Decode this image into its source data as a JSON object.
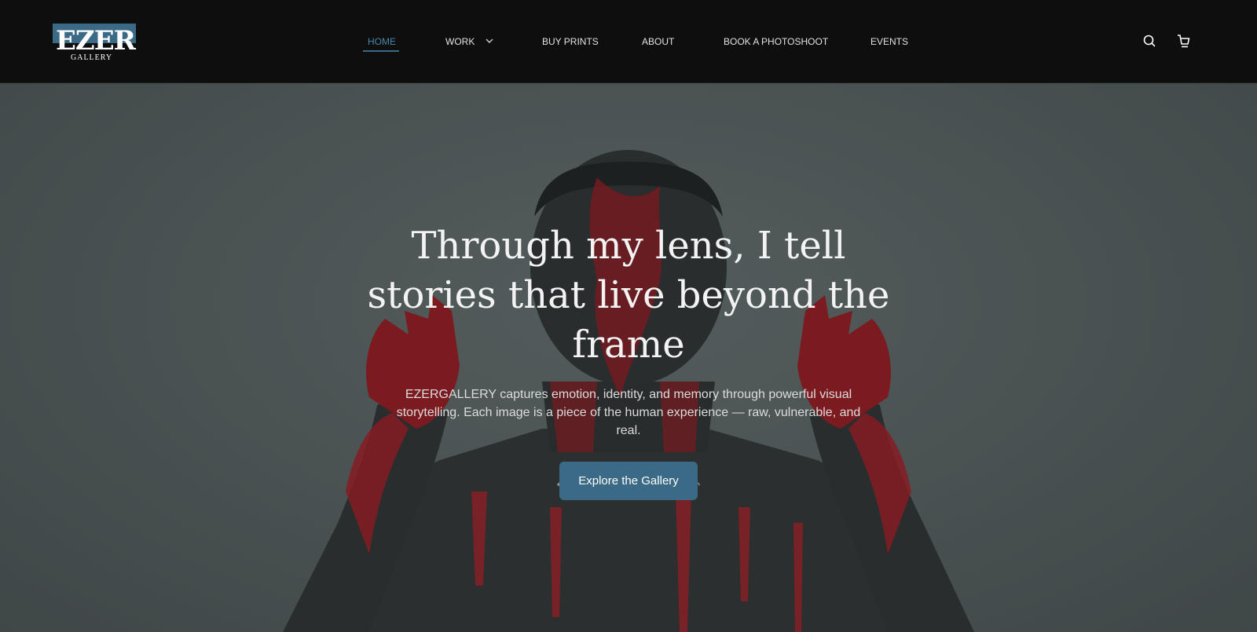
{
  "brand": {
    "logo_main": "EZER",
    "logo_sub": "GALLERY",
    "accent": "#3a6a86"
  },
  "nav": {
    "items": [
      {
        "label": "HOME",
        "active": true
      },
      {
        "label": "WORK",
        "has_dropdown": true
      },
      {
        "label": "BUY PRINTS"
      },
      {
        "label": "ABOUT"
      },
      {
        "label": "BOOK A PHOTOSHOOT"
      },
      {
        "label": "EVENTS"
      }
    ],
    "icons": [
      "search-icon",
      "cart-icon"
    ]
  },
  "hero": {
    "headline": "Through my lens, I tell stories that live beyond the frame",
    "description": "EZERGALLERY captures emotion, identity, and memory through powerful visual storytelling. Each image is a piece of the human experience — raw, vulnerable, and real.",
    "cta_label": "Explore the Gallery",
    "image_subject": "shirtless man with red paint on face, chest and raised hands"
  },
  "colors": {
    "header_bg": "#0e0e0e",
    "nav_active": "#4a87ab",
    "paint_red": "#b01a22"
  }
}
